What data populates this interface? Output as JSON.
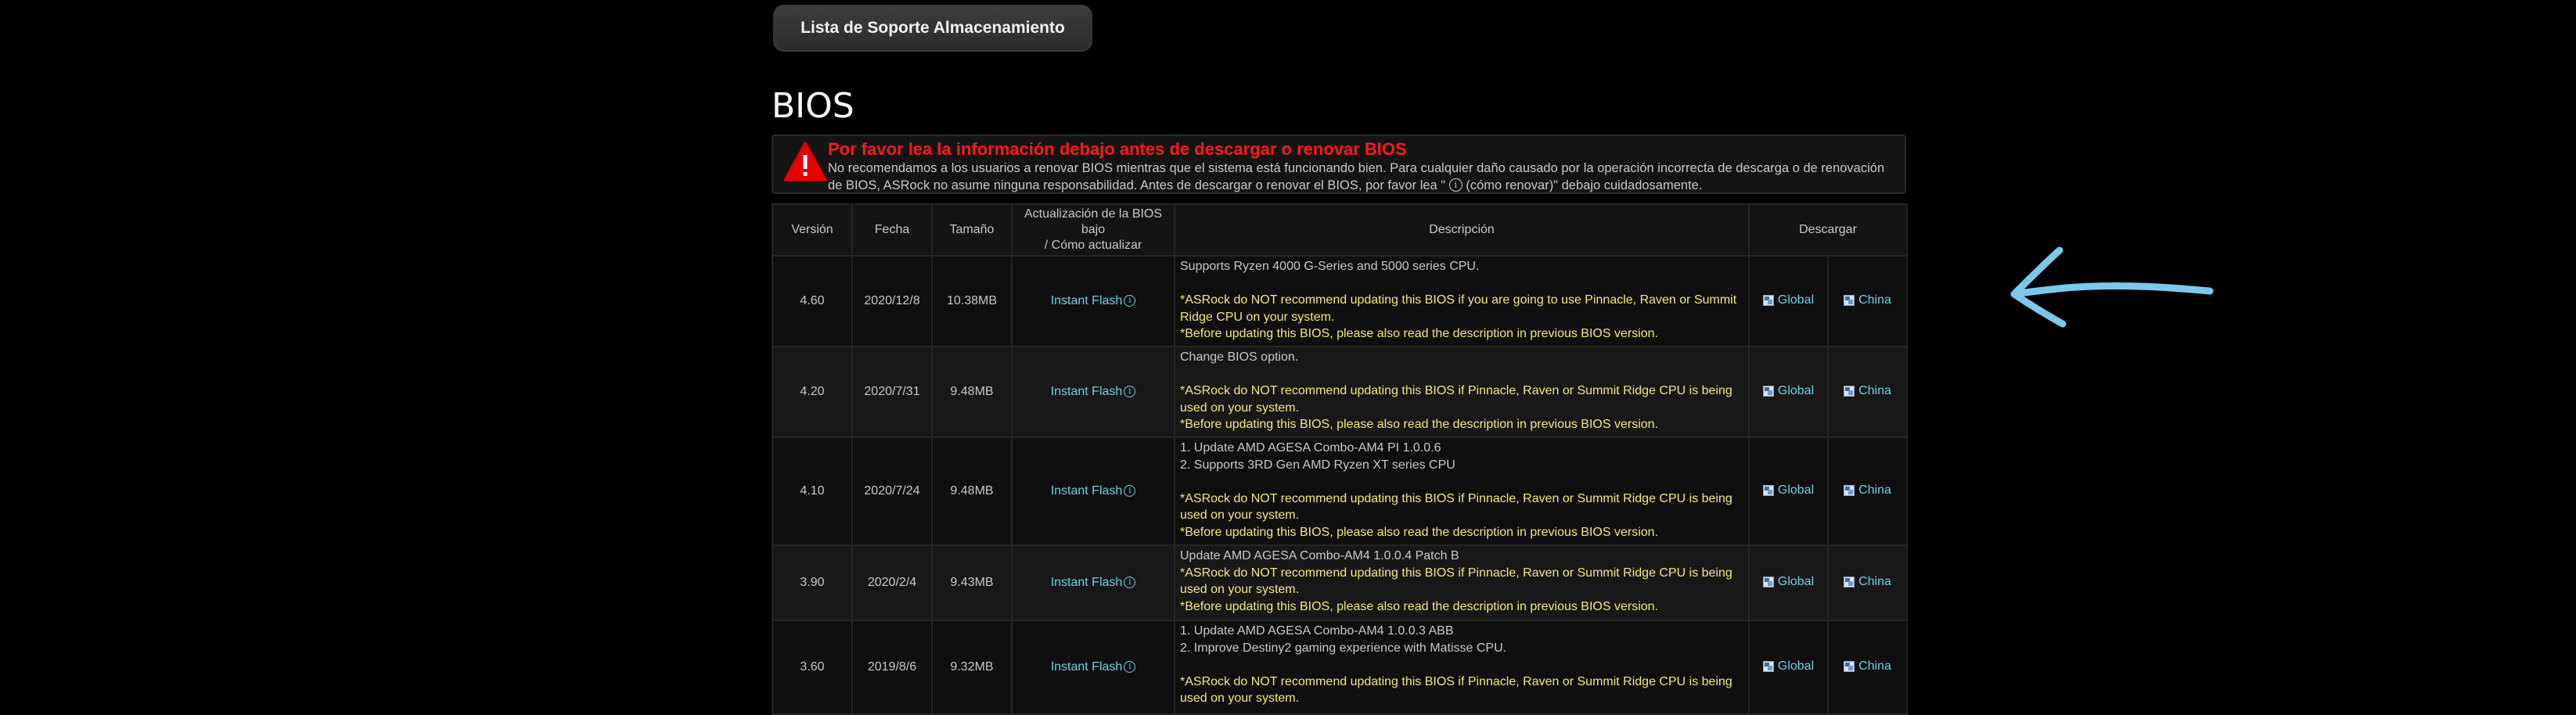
{
  "storage_button": {
    "label": "Lista de Soporte Almacenamiento"
  },
  "section": {
    "title": "BIOS"
  },
  "warning": {
    "title": "Por favor lea la información debajo antes de descargar o renovar BIOS",
    "text_before_icon": "No recomendamos a los usuarios a renovar BIOS mientras que el sistema está funcionando bien. Para cualquier daño causado por la operación incorrecta de descarga o de renovación de BIOS, ASRock no asume ninguna responsabilidad. Antes de descargar o renovar el BIOS, por favor lea \" ",
    "text_after_icon": " (cómo renovar)\" debajo cuidadosamente.",
    "icon": "warning-triangle-icon",
    "title_color": "#ff1a1a"
  },
  "table": {
    "headers": {
      "version": "Versión",
      "date": "Fecha",
      "size": "Tamaño",
      "update_line1": "Actualización de la BIOS",
      "update_line2": "bajo",
      "update_line3": "/ Cómo actualizar",
      "description": "Descripción",
      "download": "Descargar"
    },
    "rows": [
      {
        "version": "4.60",
        "date": "2020/12/8",
        "size": "10.38MB",
        "update": "Instant Flash",
        "desc_plain": [
          "Supports Ryzen 4000 G-Series and 5000 series CPU."
        ],
        "desc_yellow": [
          "*ASRock do NOT recommend updating this BIOS if you are going to use Pinnacle, Raven or Summit Ridge CPU on your system.",
          "*Before updating this BIOS, please also read the description in previous BIOS version."
        ],
        "global": "Global",
        "china": "China"
      },
      {
        "version": "4.20",
        "date": "2020/7/31",
        "size": "9.48MB",
        "update": "Instant Flash",
        "desc_plain": [
          "Change BIOS option."
        ],
        "desc_yellow": [
          "*ASRock do NOT recommend updating this BIOS if Pinnacle, Raven or Summit Ridge CPU is being used on your system.",
          "*Before updating this BIOS, please also read the description in previous BIOS version."
        ],
        "global": "Global",
        "china": "China"
      },
      {
        "version": "4.10",
        "date": "2020/7/24",
        "size": "9.48MB",
        "update": "Instant Flash",
        "desc_plain": [
          "1. Update AMD AGESA Combo-AM4 PI 1.0.0.6",
          "2. Supports 3RD Gen AMD Ryzen XT series CPU"
        ],
        "desc_yellow": [
          "*ASRock do NOT recommend updating this BIOS if Pinnacle, Raven or Summit Ridge CPU is being used on your system.",
          "*Before updating this BIOS, please also read the description in previous BIOS version."
        ],
        "global": "Global",
        "china": "China"
      },
      {
        "version": "3.90",
        "date": "2020/2/4",
        "size": "9.43MB",
        "update": "Instant Flash",
        "desc_plain": [
          "Update AMD AGESA Combo-AM4 1.0.0.4 Patch B"
        ],
        "desc_yellow": [
          "*ASRock do NOT recommend updating this BIOS if Pinnacle, Raven or Summit Ridge CPU is being used on your system.",
          "*Before updating this BIOS, please also read the description in previous BIOS version."
        ],
        "global": "Global",
        "china": "China"
      },
      {
        "version": "3.60",
        "date": "2019/8/6",
        "size": "9.32MB",
        "update": "Instant Flash",
        "desc_plain": [
          "1. Update AMD AGESA Combo-AM4 1.0.0.3 ABB",
          "2. Improve Destiny2 gaming experience with Matisse CPU."
        ],
        "desc_yellow": [
          "*ASRock do NOT recommend updating this BIOS if Pinnacle, Raven or Summit Ridge CPU is being used on your system."
        ],
        "global": "Global",
        "china": "China"
      }
    ]
  },
  "colors": {
    "background": "#000000",
    "link": "#6fd0e0",
    "note_text": "#f0e880",
    "annotation_arrow": "#7cc8ec"
  }
}
